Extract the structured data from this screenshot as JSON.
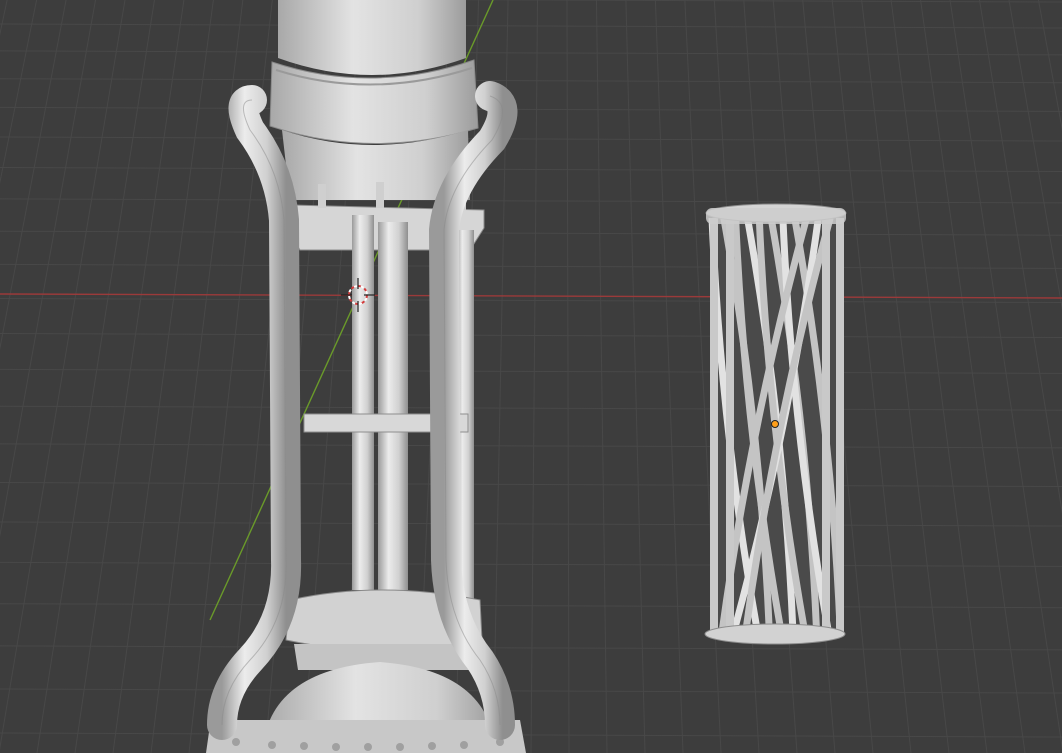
{
  "app": {
    "name": "3D viewport",
    "view_mode": "solid",
    "grid": true
  },
  "colors": {
    "background": "#3d3d3d",
    "grid_line": "#484848",
    "grid_line_major": "#505050",
    "x_axis": "#9b3a3a",
    "y_axis": "#6a9a2a",
    "mesh_light": "#e6e6e6",
    "mesh_mid": "#bdbdbd",
    "mesh_dark": "#8a8a8a",
    "cursor_red": "#d43c3c",
    "origin_dot": "#ff9f1a"
  },
  "objects": [
    {
      "name": "engine-assembly",
      "selected": false
    },
    {
      "name": "twisted-cage-cylinder",
      "selected": true
    }
  ],
  "icons": [
    "3d-cursor-icon",
    "object-origin-icon"
  ]
}
